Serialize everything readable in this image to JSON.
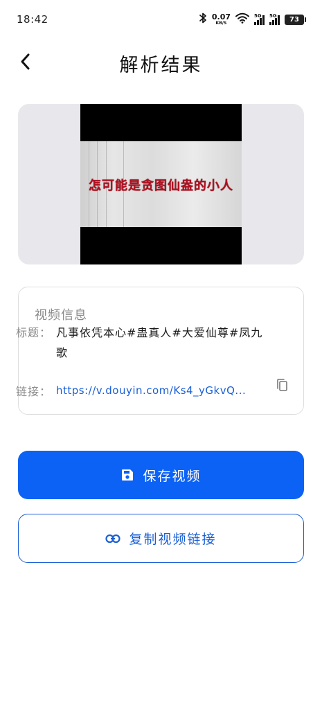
{
  "status_bar": {
    "time": "18:42",
    "net_speed": "0.07",
    "net_unit": "KB/S",
    "signal_1_label": "5G",
    "signal_2_label": "5G",
    "battery": "73"
  },
  "header": {
    "title": "解析结果",
    "back_icon": "chevron-left-icon"
  },
  "preview": {
    "subtitle": "怎可能是贪图仙盎的小人"
  },
  "info": {
    "heading": "视频信息",
    "title_label": "标题：",
    "title_value": "凡事依凭本心#蛊真人#大爱仙尊#凤九歌",
    "link_label": "链接：",
    "link_value": "https://v.douyin.com/Ks4_yGkvQ...",
    "copy_icon": "copy-icon"
  },
  "actions": {
    "save_label": "保存视频",
    "save_icon": "save-icon",
    "copy_link_label": "复制视频链接",
    "link_icon": "link-icon"
  },
  "colors": {
    "primary": "#0b62f5",
    "link": "#1a5fd6",
    "subtitle": "#b01020"
  }
}
